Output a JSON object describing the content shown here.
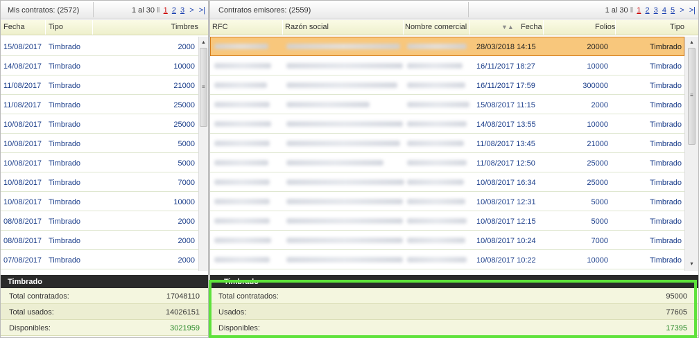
{
  "left": {
    "title": "Mis contratos: (2572)",
    "pager": {
      "range": "1 al 30",
      "bar": "‖",
      "current": "1",
      "pages": [
        "2",
        "3"
      ],
      "next": ">",
      "last": ">|"
    },
    "columns": [
      "Fecha",
      "Tipo",
      "Timbres"
    ],
    "rows": [
      [
        "15/08/2017",
        "Timbrado",
        "2000"
      ],
      [
        "14/08/2017",
        "Timbrado",
        "10000"
      ],
      [
        "11/08/2017",
        "Timbrado",
        "21000"
      ],
      [
        "11/08/2017",
        "Timbrado",
        "25000"
      ],
      [
        "10/08/2017",
        "Timbrado",
        "25000"
      ],
      [
        "10/08/2017",
        "Timbrado",
        "5000"
      ],
      [
        "10/08/2017",
        "Timbrado",
        "5000"
      ],
      [
        "10/08/2017",
        "Timbrado",
        "7000"
      ],
      [
        "10/08/2017",
        "Timbrado",
        "10000"
      ],
      [
        "08/08/2017",
        "Timbrado",
        "2000"
      ],
      [
        "08/08/2017",
        "Timbrado",
        "2000"
      ],
      [
        "07/08/2017",
        "Timbrado",
        "2000"
      ]
    ],
    "summary": {
      "title": "Timbrado",
      "items": [
        {
          "label": "Total contratados:",
          "value": "17048110"
        },
        {
          "label": "Total usados:",
          "value": "14026151"
        },
        {
          "label": "Disponibles:",
          "value": "3021959"
        }
      ]
    }
  },
  "right": {
    "title": "Contratos emisores: (2559)",
    "pager": {
      "range": "1 al 30",
      "bar": "‖",
      "current": "1",
      "pages": [
        "2",
        "3",
        "4",
        "5"
      ],
      "next": ">",
      "last": ">|"
    },
    "columns": [
      "RFC",
      "Razón social",
      "Nombre comercial",
      "Fecha",
      "Folios",
      "Tipo"
    ],
    "rows": [
      [
        "28/03/2018 14:15",
        "20000",
        "Timbrado"
      ],
      [
        "16/11/2017 18:27",
        "10000",
        "Timbrado"
      ],
      [
        "16/11/2017 17:59",
        "300000",
        "Timbrado"
      ],
      [
        "15/08/2017 11:15",
        "2000",
        "Timbrado"
      ],
      [
        "14/08/2017 13:55",
        "10000",
        "Timbrado"
      ],
      [
        "11/08/2017 13:45",
        "21000",
        "Timbrado"
      ],
      [
        "11/08/2017 12:50",
        "25000",
        "Timbrado"
      ],
      [
        "10/08/2017 16:34",
        "25000",
        "Timbrado"
      ],
      [
        "10/08/2017 12:31",
        "5000",
        "Timbrado"
      ],
      [
        "10/08/2017 12:15",
        "5000",
        "Timbrado"
      ],
      [
        "10/08/2017 10:24",
        "7000",
        "Timbrado"
      ],
      [
        "10/08/2017 10:22",
        "10000",
        "Timbrado"
      ]
    ],
    "selected_row": 0,
    "summary": {
      "title": "Timbrado",
      "items": [
        {
          "label": "Total contratados:",
          "value": "95000"
        },
        {
          "label": "Usados:",
          "value": "77605"
        },
        {
          "label": "Disponibles:",
          "value": "17395"
        }
      ]
    }
  },
  "icons": {
    "sort": "sort-arrows-icon",
    "scroll_up": "arrow-up-icon",
    "scroll_down": "arrow-down-icon"
  },
  "colors": {
    "accent_highlight": "#5ee23b",
    "selected_row": "#f8c77c",
    "available_value": "#2a8a2a"
  }
}
